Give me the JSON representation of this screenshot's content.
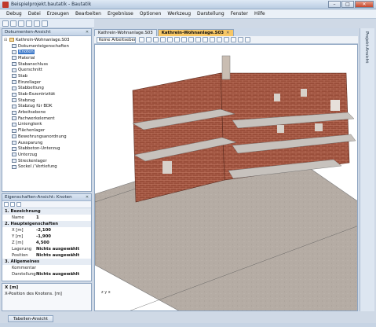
{
  "window": {
    "title": "Beispielprojekt.bautatik - Bautatik"
  },
  "menu": [
    "Debug",
    "Datei",
    "Erzeugen",
    "Bearbeiten",
    "Ergebnisse",
    "Optionen",
    "Werkzeug",
    "Darstellung",
    "Fenster",
    "Hilfe"
  ],
  "doc_panel": {
    "title": "Dokumenten-Ansicht",
    "root": "Kathrein-Wohnanlage.S03",
    "items": [
      "Dokumenteigenschaften",
      "Knoten",
      "Material",
      "Stabanschluss",
      "Querschnitt",
      "Stab",
      "Einzellager",
      "Stabbettung",
      "Stab-Exzentrizität",
      "Stabzug",
      "Stabzug für BDK",
      "Arbeitsebene",
      "Fachwerkelement",
      "Linienglenk",
      "Flächenlager",
      "Bewehrungsanordnung",
      "Aussparung",
      "Stabbeton-Unterzug",
      "Unterzug",
      "Streckenlager",
      "Sockel / Vertiefung"
    ],
    "selected": "Knoten"
  },
  "prop_panel": {
    "title": "Eigenschaften-Ansicht: Knoten",
    "sections": [
      {
        "label": "1. Bezeichnung",
        "rows": [
          {
            "key": "Name",
            "value": "1"
          }
        ]
      },
      {
        "label": "2. Haupteigenschaften",
        "rows": [
          {
            "key": "X [m]",
            "value": "-2,100"
          },
          {
            "key": "Y [m]",
            "value": "-1,900"
          },
          {
            "key": "Z [m]",
            "value": "4,500"
          },
          {
            "key": "Lagerung",
            "value": "Nichts ausgewählt"
          },
          {
            "key": "Position",
            "value": "Nichts ausgewählt"
          }
        ]
      },
      {
        "label": "3. Allgemeines",
        "rows": [
          {
            "key": "Kommentar",
            "value": ""
          },
          {
            "key": "Darstellung",
            "value": "Nichts ausgewählt"
          }
        ]
      }
    ]
  },
  "description": {
    "title": "X [m]",
    "text": "X-Position des Knotens. [m]"
  },
  "bottom_tab": "Tabellen-Ansicht",
  "doc_tabs": [
    {
      "label": "Kathrein-Wohnanlage.S03",
      "active": false
    },
    {
      "label": "Kathrein-Wohnanlage.S03",
      "active": true
    }
  ],
  "view_toolbar": {
    "layer_select": "Keine Arbeitsebene"
  },
  "right_strip": {
    "label": "Projekt-Ansicht"
  },
  "viewport": {
    "axis_label": "z y x"
  },
  "colors": {
    "brick": "#9a4e3a",
    "ground": "#b5aca4",
    "slab": "#c7c2bd",
    "accent": "#f7c766"
  }
}
